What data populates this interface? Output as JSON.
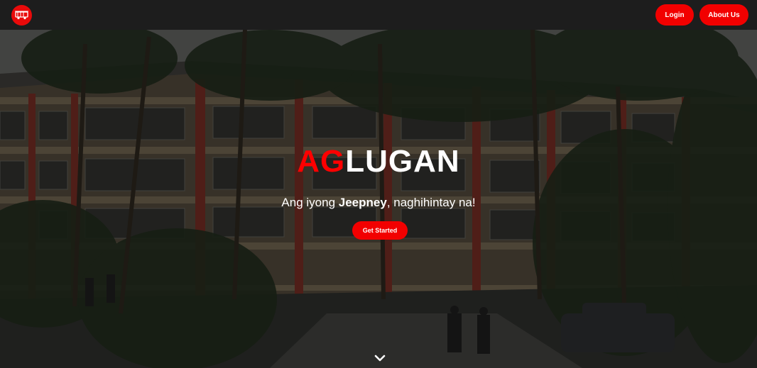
{
  "nav": {
    "logo_icon": "jeepney-icon",
    "login_label": "Login",
    "about_label": "About Us"
  },
  "hero": {
    "brand_accent": "AG",
    "brand_rest": "LUGAN",
    "tagline_prefix": "Ang iyong ",
    "tagline_bold": "Jeepney",
    "tagline_suffix": ", naghihintay na!",
    "cta_label": "Get Started",
    "scroll_icon": "chevron-down-icon"
  },
  "colors": {
    "accent": "#f20000",
    "navbar": "#1d1d1d",
    "text": "#ffffff"
  }
}
